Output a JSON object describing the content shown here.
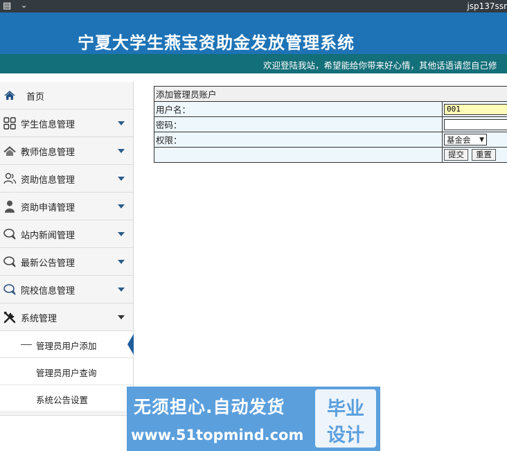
{
  "browser": {
    "menu_icon": "window-icon",
    "title_fragment": "jsp137ssr"
  },
  "header": {
    "site_title": "宁夏大学生燕宝资助金发放管理系统",
    "welcome": "欢迎登陆我站，希望能给你带来好心情，其他话语请您自己修"
  },
  "sidebar": {
    "items": [
      {
        "label": "首页",
        "icon": "home-icon",
        "has_caret": false
      },
      {
        "label": "学生信息管理",
        "icon": "grid-icon",
        "has_caret": true
      },
      {
        "label": "教师信息管理",
        "icon": "house-icon",
        "has_caret": true
      },
      {
        "label": "资助信息管理",
        "icon": "users-icon",
        "has_caret": true
      },
      {
        "label": "资助申请管理",
        "icon": "person-icon",
        "has_caret": true
      },
      {
        "label": "站内新闻管理",
        "icon": "chat-icon",
        "has_caret": true
      },
      {
        "label": "最新公告管理",
        "icon": "chat-icon",
        "has_caret": true
      },
      {
        "label": "院校信息管理",
        "icon": "chat-icon",
        "has_caret": true
      },
      {
        "label": "系统管理",
        "icon": "tools-icon",
        "has_caret": true,
        "expanded": true
      }
    ],
    "sub_items": [
      {
        "label": "管理员用户添加",
        "active": true
      },
      {
        "label": "管理员用户查询",
        "active": false
      },
      {
        "label": "系统公告设置",
        "active": false
      }
    ]
  },
  "form": {
    "caption": "添加管理员账户",
    "username_label": "用户名：",
    "username_value": "001",
    "password_label": "密码：",
    "password_value": "",
    "role_label": "权限：",
    "role_selected": "基金会",
    "submit_label": "提交",
    "reset_label": "重置"
  },
  "watermark": {
    "line1": "无须担心.自动发货",
    "line2": "www.51topmind.com",
    "badge_line1": "毕业",
    "badge_line2": "设计"
  },
  "colors": {
    "header_blue": "#1e73b6",
    "subheader_teal": "#136f79",
    "watermark_blue": "#5b9fdd",
    "input_yellow": "#fffbb8"
  }
}
